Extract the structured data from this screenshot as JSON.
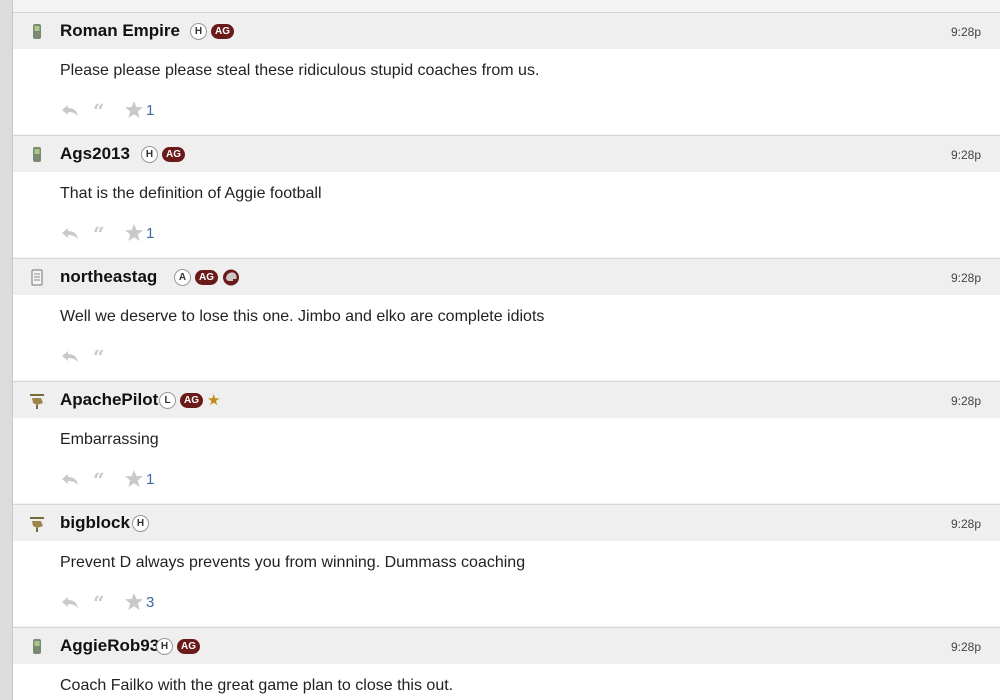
{
  "posts": [
    {
      "username": "Roman Empire",
      "level": "H",
      "team": "AG",
      "extra": "",
      "time": "9:28p",
      "text": "Please please please steal these ridiculous stupid coaches from us.",
      "stars": "1",
      "avatar": "phone-icon"
    },
    {
      "username": "Ags2013",
      "level": "H",
      "team": "AG",
      "extra": "",
      "time": "9:28p",
      "text": "That is the definition of Aggie football",
      "stars": "1",
      "avatar": "phone-icon"
    },
    {
      "username": "northeastag",
      "level": "A",
      "team": "AG",
      "extra": "helmet-badge",
      "time": "9:28p",
      "text": "Well we deserve to lose this one. Jimbo and elko are complete idiots",
      "stars": "",
      "avatar": "document-icon"
    },
    {
      "username": "ApachePilot",
      "level": "L",
      "team": "AG",
      "extra": "gold-star",
      "time": "9:28p",
      "text": "Embarrassing",
      "stars": "1",
      "avatar": "helicopter-icon"
    },
    {
      "username": "bigblock",
      "level": "H",
      "team": "",
      "extra": "",
      "time": "9:28p",
      "text": "Prevent D always prevents you from winning. Dummass coaching",
      "stars": "3",
      "avatar": "helicopter-icon"
    },
    {
      "username": "AggieRob93",
      "level": "H",
      "team": "AG",
      "extra": "",
      "time": "9:28p",
      "text": "Coach Failko with the great game plan to close this out.",
      "stars": "",
      "avatar": "phone-icon"
    }
  ],
  "colors": {
    "team_badge": "#6b1a1a",
    "star_count": "#3d6aa0",
    "gold_star": "#c08a1a"
  }
}
